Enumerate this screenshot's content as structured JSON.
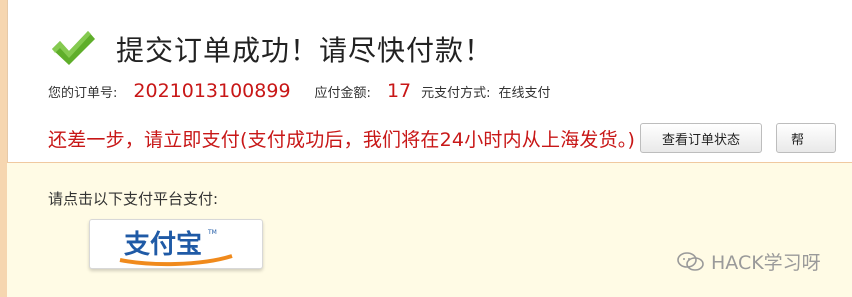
{
  "header": {
    "title": "提交订单成功！请尽快付款！"
  },
  "order": {
    "number_label": "您的订单号:",
    "number": "2021013100899",
    "amount_label": "应付金额:",
    "amount": "17",
    "payment_method_label": "元支付方式:",
    "payment_method": "在线支付"
  },
  "notice": {
    "text": "还差一步，请立即支付(支付成功后，我们将在24小时内从上海发货。)",
    "check_status_label": "查看订单状态",
    "help_label": "帮"
  },
  "payment": {
    "platform_label": "请点击以下支付平台支付:",
    "alipay_logo_text": "支付宝",
    "alipay_tm": "TM"
  },
  "watermark": {
    "text": "HACK学习呀"
  },
  "colors": {
    "accent_red": "#c81717",
    "check_green": "#5fae2a",
    "pay_box_bg": "#fffbe5",
    "alipay_blue": "#1f5aa6",
    "alipay_orange": "#f08a1c"
  }
}
